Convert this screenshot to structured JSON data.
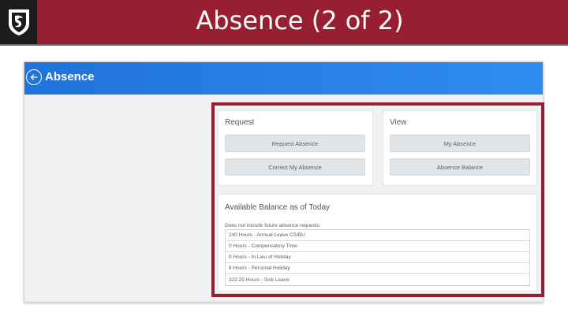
{
  "slide": {
    "title": "Absence (2 of 2)"
  },
  "app": {
    "title": "Absence"
  },
  "request": {
    "label": "Request",
    "buttons": [
      "Request Absence",
      "Correct My Absence"
    ]
  },
  "view": {
    "label": "View",
    "buttons": [
      "My Absence",
      "Absence Balance"
    ]
  },
  "balance": {
    "title": "Available Balance as of Today",
    "note": "Does not include future absence requests",
    "rows": [
      "240 Hours - Annual Leave CS/BU",
      "0 Hours - Compensatory Time",
      "0 Hours - In Lieu of Holiday",
      "8 Hours - Personal Holiday",
      "322.25 Hours - Sick Leave"
    ]
  },
  "colors": {
    "brand_crimson": "#981e32",
    "header_blue": "#1f73da",
    "logo_bg": "#1c1c1c"
  },
  "icons": [
    "cougar-logo-icon",
    "back-arrow-icon"
  ]
}
